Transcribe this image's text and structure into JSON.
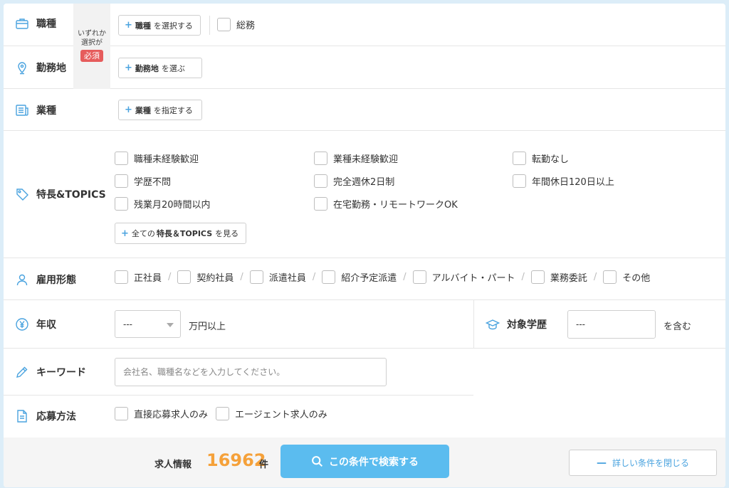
{
  "required": {
    "line1": "いずれか",
    "line2": "選択が",
    "badge": "必須"
  },
  "job_type": {
    "label": "職種",
    "button_bold": "職種",
    "button_rest": "を選択する",
    "selected_option": "総務"
  },
  "location": {
    "label": "勤務地",
    "button_bold": "勤務地",
    "button_rest": "を選ぶ"
  },
  "industry": {
    "label": "業種",
    "button_bold": "業種",
    "button_rest": "を指定する"
  },
  "features": {
    "label": "特長&TOPICS",
    "options": [
      "職種未経験歓迎",
      "業種未経験歓迎",
      "転勤なし",
      "学歴不問",
      "完全週休2日制",
      "年間休日120日以上",
      "残業月20時間以内",
      "在宅勤務・リモートワークOK"
    ],
    "more_prefix": "全ての",
    "more_bold": "特長＆TOPICS",
    "more_suffix": "を見る"
  },
  "employment": {
    "label": "雇用形態",
    "options": [
      "正社員",
      "契約社員",
      "派遣社員",
      "紹介予定派遣",
      "アルバイト・パート",
      "業務委託",
      "その他"
    ],
    "separator": "/"
  },
  "salary": {
    "label": "年収",
    "value": "---",
    "unit": "万円以上"
  },
  "education": {
    "label": "対象学歴",
    "value": "---",
    "suffix": "を含む"
  },
  "keyword": {
    "label": "キーワード",
    "placeholder": "会社名、職種名などを入力してください。"
  },
  "apply_method": {
    "label": "応募方法",
    "options": [
      "直接応募求人のみ",
      "エージェント求人のみ"
    ]
  },
  "footer": {
    "count_label": "求人情報",
    "count": "16962",
    "count_unit": "件",
    "search_label": "この条件で検索する",
    "close_label": "詳しい条件を閉じる"
  },
  "colors": {
    "accent": "#4aa3df",
    "search": "#5bbcef",
    "count": "#f5a13a",
    "badge": "#e65c5c"
  },
  "icons": {
    "job_type": "briefcase-icon",
    "location": "map-pin-icon",
    "industry": "newspaper-icon",
    "features": "tag-icon",
    "employment": "person-icon",
    "salary": "yen-circle-icon",
    "education": "graduation-cap-icon",
    "keyword": "pencil-icon",
    "apply_method": "document-icon",
    "search": "search-icon"
  }
}
